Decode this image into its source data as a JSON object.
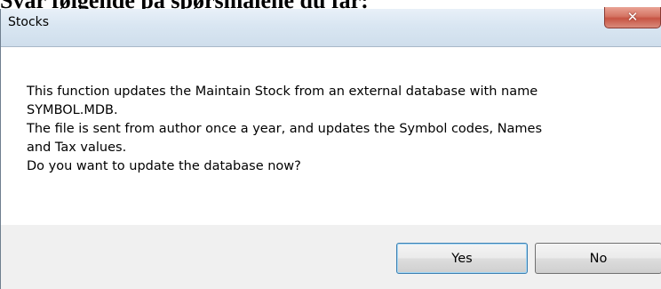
{
  "document": {
    "heading": "Svar følgende på spørsmålene du får:"
  },
  "dialog": {
    "title": "Stocks",
    "close_glyph": "✕",
    "message_lines": [
      "This function updates the Maintain Stock from an external database with name",
      "SYMBOL.MDB.",
      "The file is sent from author once a year, and updates the Symbol codes, Names",
      "and Tax values.",
      "Do you want to update the database now?"
    ],
    "buttons": {
      "yes_label": "Yes",
      "no_label": "No"
    }
  },
  "colors": {
    "titlebar": "#d9e6f2",
    "close_button": "#c75443",
    "footer": "#f0f0f0",
    "default_button_border": "#3c7fb1"
  }
}
